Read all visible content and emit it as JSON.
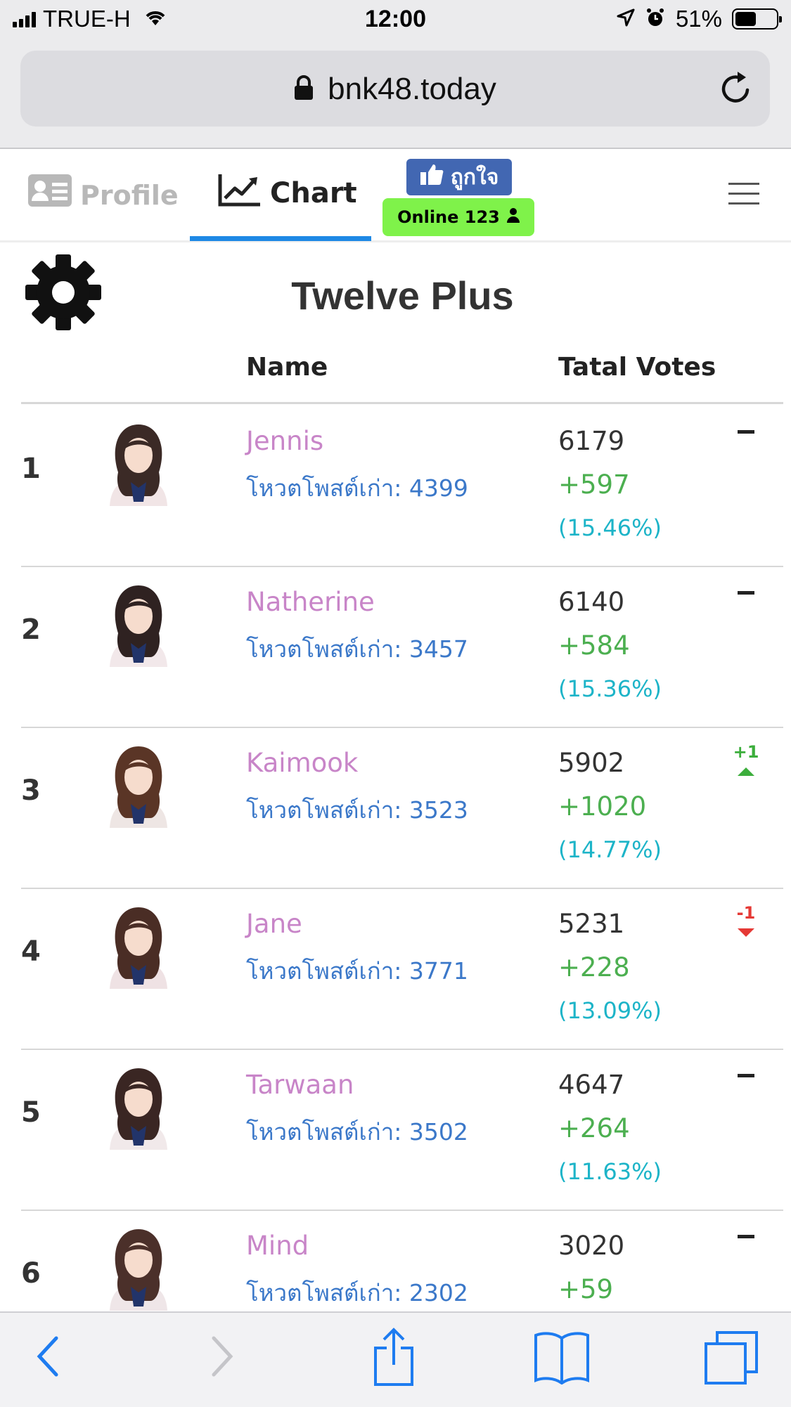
{
  "status": {
    "carrier": "TRUE-H",
    "time": "12:00",
    "battery": "51%",
    "battery_level": 0.51
  },
  "browser": {
    "url": "bnk48.today"
  },
  "nav": {
    "profile_label": "Profile",
    "chart_label": "Chart",
    "like_label": "ถูกใจ",
    "online_label": "Online 123"
  },
  "page": {
    "title": "Twelve Plus",
    "col_name": "Name",
    "col_votes": "Tatal Votes"
  },
  "members": [
    {
      "rank": "1",
      "name": "Jennis",
      "old_votes": "โหวตโพสต์เก่า: 4399",
      "total": "6179",
      "gain": "+597",
      "pct": "(15.46%)",
      "change": ""
    },
    {
      "rank": "2",
      "name": "Natherine",
      "old_votes": "โหวตโพสต์เก่า: 3457",
      "total": "6140",
      "gain": "+584",
      "pct": "(15.36%)",
      "change": ""
    },
    {
      "rank": "3",
      "name": "Kaimook",
      "old_votes": "โหวตโพสต์เก่า: 3523",
      "total": "5902",
      "gain": "+1020",
      "pct": "(14.77%)",
      "change": "+1"
    },
    {
      "rank": "4",
      "name": "Jane",
      "old_votes": "โหวตโพสต์เก่า: 3771",
      "total": "5231",
      "gain": "+228",
      "pct": "(13.09%)",
      "change": "-1"
    },
    {
      "rank": "5",
      "name": "Tarwaan",
      "old_votes": "โหวตโพสต์เก่า: 3502",
      "total": "4647",
      "gain": "+264",
      "pct": "(11.63%)",
      "change": ""
    },
    {
      "rank": "6",
      "name": "Mind",
      "old_votes": "โหวตโพสต์เก่า: 2302",
      "total": "3020",
      "gain": "+59",
      "pct": "",
      "change": ""
    }
  ],
  "icons": {
    "settings": "gear-icon",
    "profile": "profile-card-icon",
    "chart": "trend-chart-icon",
    "like": "thumbs-up-icon",
    "user": "user-icon",
    "menu": "hamburger-menu-icon",
    "back": "chevron-left-icon",
    "forward": "chevron-right-icon",
    "share": "share-icon",
    "bookmarks": "book-icon",
    "tabs": "tabs-icon"
  },
  "colors": {
    "accent_blue": "#1e88e5",
    "name_pink": "#c885c8",
    "old_vote_blue": "#3b78c9",
    "gain_green": "#4caf50",
    "pct_cyan": "#1db4c8",
    "like_blue": "#4267b2",
    "online_green": "#7ff24a"
  }
}
